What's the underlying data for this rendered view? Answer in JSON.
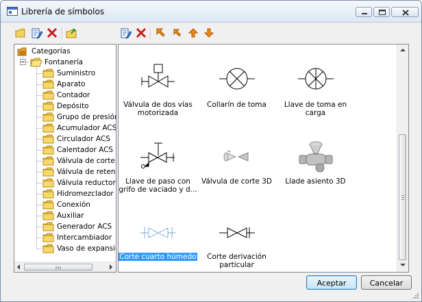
{
  "window": {
    "title": "Librería de símbolos"
  },
  "icons": {
    "new_category": "folder-new-icon",
    "edit_category": "edit-icon",
    "delete_category": "delete-icon",
    "import": "folder-import-icon",
    "edit_symbol": "edit-icon",
    "delete_symbol": "delete-icon",
    "move_first": "arrow-up-left-icon",
    "move_prev": "arrow-up-left-small-icon",
    "move_up": "arrow-up-icon",
    "move_down": "arrow-down-icon"
  },
  "tree": {
    "root": "Categorías",
    "group": "Fontanería",
    "items": [
      "Suministro",
      "Aparato",
      "Contador",
      "Depósito",
      "Grupo de presión",
      "Acumulador ACS",
      "Circulador ACS",
      "Calentador ACS",
      "Válvula de corte",
      "Válvula de retenc",
      "Válvula reductora",
      "Hidromezclador",
      "Conexión",
      "Auxiliar",
      "Generador ACS",
      "Intercambiador",
      "Vaso de expansió"
    ]
  },
  "symbols": [
    {
      "label": "Válvula de dos vías\nmotorizada"
    },
    {
      "label": "Collarín de toma"
    },
    {
      "label": "Llave de toma en\ncarga"
    },
    {
      "label": "Llave de paso con\ngrifo de vaciado y d..."
    },
    {
      "label": "Válvula de corte 3D"
    },
    {
      "label": "Llade asiento 3D"
    },
    {
      "label": "Corte cuarto húmedo",
      "selected": true
    },
    {
      "label": "Corte derivación\nparticular"
    }
  ],
  "buttons": {
    "accept": "Aceptar",
    "cancel": "Cancelar"
  },
  "colors": {
    "selection": "#3399ff",
    "delete": "#cc1a1a",
    "move_arrows": "#e07b00",
    "folder": "#f5d25e"
  }
}
